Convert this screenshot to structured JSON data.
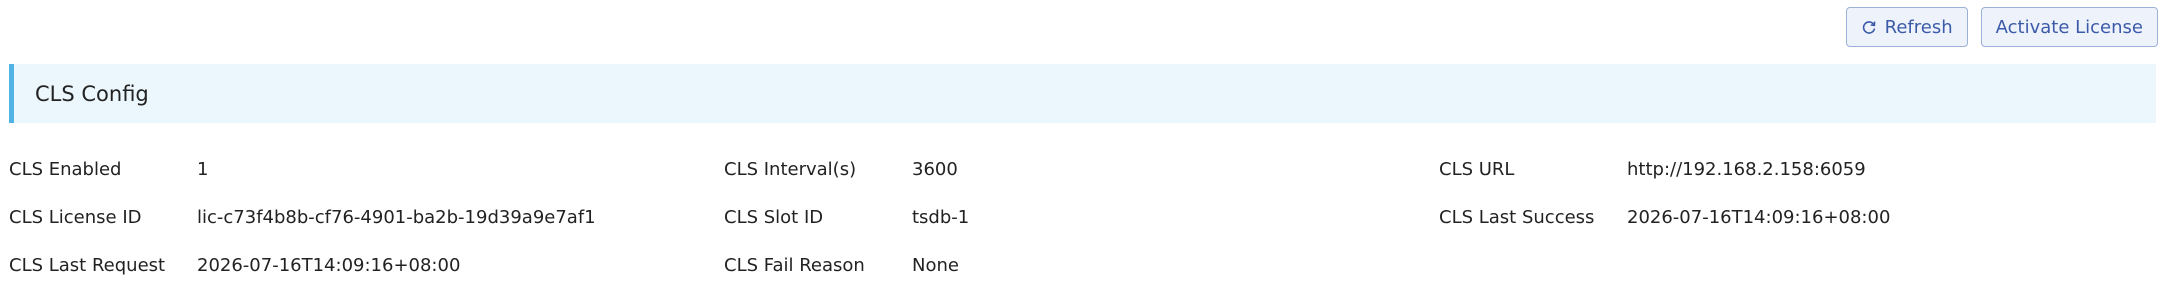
{
  "toolbar": {
    "refresh_label": "Refresh",
    "refresh_icon": "refresh-icon",
    "activate_label": "Activate License"
  },
  "section": {
    "title": "CLS Config"
  },
  "fields": [
    {
      "label": "CLS Enabled",
      "value": "1"
    },
    {
      "label": "CLS Interval(s)",
      "value": "3600"
    },
    {
      "label": "CLS URL",
      "value": "http://192.168.2.158:6059"
    },
    {
      "label": "CLS License ID",
      "value": "lic-c73f4b8b-cf76-4901-ba2b-19d39a9e7af1"
    },
    {
      "label": "CLS Slot ID",
      "value": "tsdb-1"
    },
    {
      "label": "CLS Last Success",
      "value": "2026-07-16T14:09:16+08:00"
    },
    {
      "label": "CLS Last Request",
      "value": "2026-07-16T14:09:16+08:00"
    },
    {
      "label": "CLS Fail Reason",
      "value": "None"
    }
  ],
  "colors": {
    "accent": "#4fb3e3",
    "section_bg": "#ecf7fd",
    "button_text": "#3b5aa8",
    "button_border": "#9bb1d6"
  }
}
